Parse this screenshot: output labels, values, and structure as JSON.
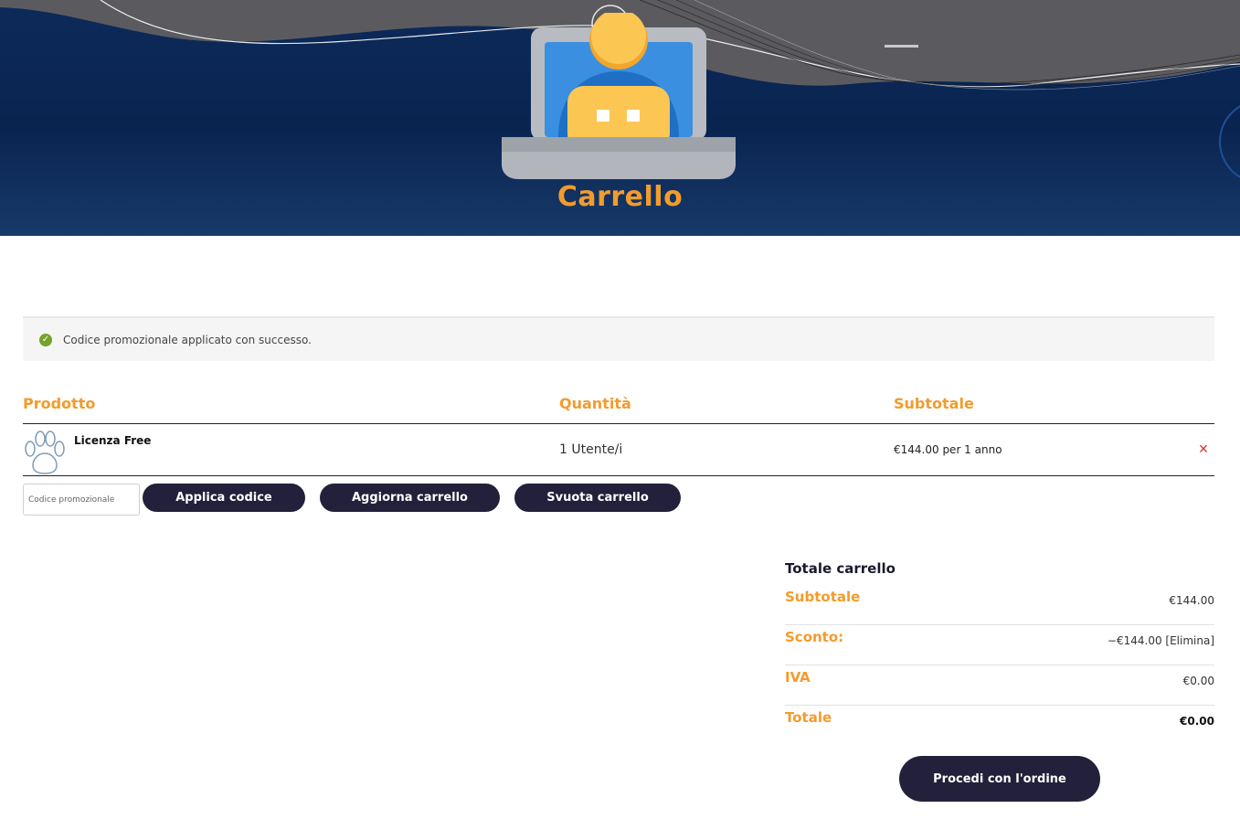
{
  "hero": {
    "title": "Carrello"
  },
  "notice": {
    "message": "Codice promozionale applicato con successo."
  },
  "cart": {
    "headers": {
      "product": "Prodotto",
      "quantity": "Quantità",
      "subtotal": "Subtotale"
    },
    "items": [
      {
        "name": "Licenza Free",
        "quantity": "1 Utente/i",
        "price": "€144.00 per 1 anno",
        "icon": "paw-icon",
        "remove": "×"
      }
    ]
  },
  "actions": {
    "coupon_placeholder": "Codice promozionale",
    "apply_label": "Applica codice",
    "update_label": "Aggiorna carrello",
    "empty_label": "Svuota carrello"
  },
  "totals": {
    "title": "Totale carrello",
    "subtotal_label": "Subtotale",
    "subtotal_value": "€144.00",
    "discount_label": "Sconto:",
    "discount_value": "−€144.00 [Elimina]",
    "vat_label": "IVA",
    "vat_value": "€0.00",
    "total_label": "Totale",
    "total_value": "€0.00",
    "checkout_label": "Procedi con l'ordine"
  },
  "colors": {
    "accent": "#f39b2c",
    "button": "#22203a",
    "hero": "#0c2a5a",
    "remove": "#e0302a",
    "success": "#74a32a"
  }
}
